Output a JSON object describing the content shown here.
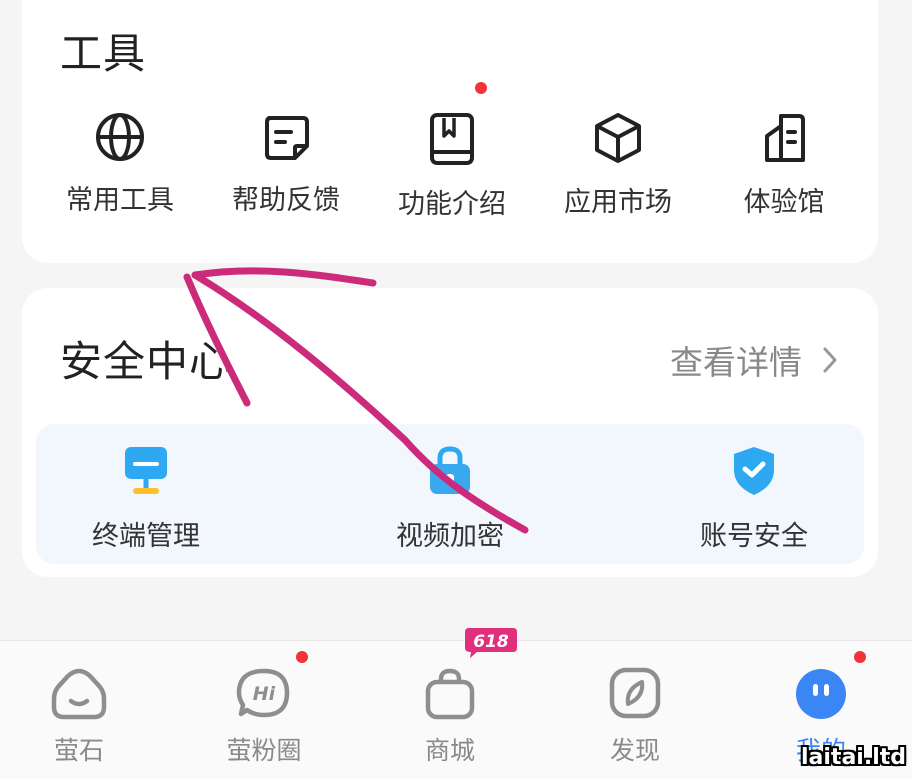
{
  "tools": {
    "title": "工具",
    "items": [
      {
        "label": "常用工具",
        "icon": "globe-icon"
      },
      {
        "label": "帮助反馈",
        "icon": "feedback-note-icon"
      },
      {
        "label": "功能介绍",
        "icon": "book-icon",
        "has_dot": true
      },
      {
        "label": "应用市场",
        "icon": "cube-icon"
      },
      {
        "label": "体验馆",
        "icon": "building-icon"
      }
    ]
  },
  "security": {
    "title": "安全中心",
    "detail_link": "查看详情",
    "items": [
      {
        "label": "终端管理",
        "icon": "terminal-icon"
      },
      {
        "label": "视频加密",
        "icon": "lock-bag-icon"
      },
      {
        "label": "账号安全",
        "icon": "shield-check-icon"
      }
    ]
  },
  "bottom_nav": {
    "items": [
      {
        "label": "萤石",
        "icon": "home-icon"
      },
      {
        "label": "萤粉圈",
        "icon": "hi-chat-icon",
        "has_dot": true
      },
      {
        "label": "商城",
        "icon": "shopping-bag-icon",
        "badge": "618"
      },
      {
        "label": "发现",
        "icon": "compass-icon"
      },
      {
        "label": "我的",
        "icon": "profile-face-icon",
        "active": true,
        "has_dot": true
      }
    ]
  },
  "watermark": "laitai.ltd",
  "colors": {
    "accent": "#3a86f5",
    "dot": "#f2333a",
    "annotation": "#cc2a7a",
    "badge": "#e0307c"
  }
}
